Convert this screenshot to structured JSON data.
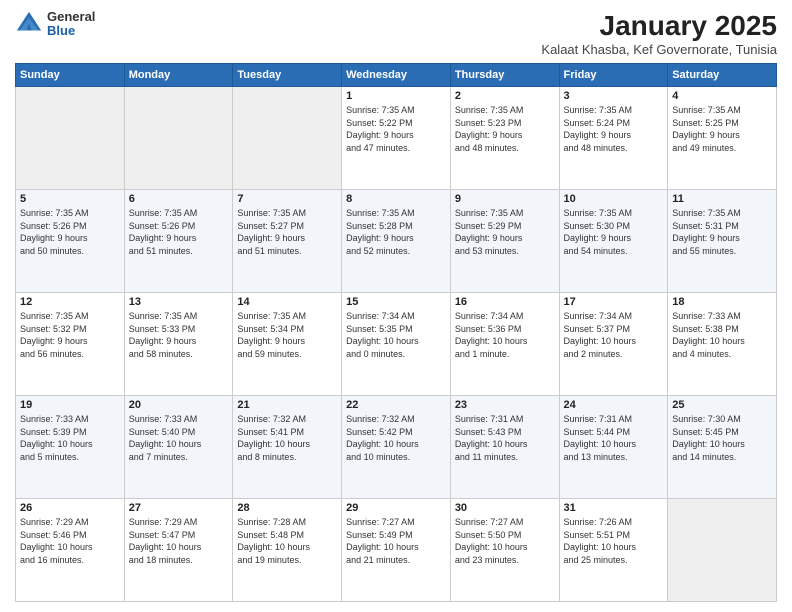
{
  "logo": {
    "general": "General",
    "blue": "Blue"
  },
  "title": "January 2025",
  "subtitle": "Kalaat Khasba, Kef Governorate, Tunisia",
  "days_of_week": [
    "Sunday",
    "Monday",
    "Tuesday",
    "Wednesday",
    "Thursday",
    "Friday",
    "Saturday"
  ],
  "weeks": [
    {
      "days": [
        {
          "num": "",
          "info": ""
        },
        {
          "num": "",
          "info": ""
        },
        {
          "num": "",
          "info": ""
        },
        {
          "num": "1",
          "info": "Sunrise: 7:35 AM\nSunset: 5:22 PM\nDaylight: 9 hours\nand 47 minutes."
        },
        {
          "num": "2",
          "info": "Sunrise: 7:35 AM\nSunset: 5:23 PM\nDaylight: 9 hours\nand 48 minutes."
        },
        {
          "num": "3",
          "info": "Sunrise: 7:35 AM\nSunset: 5:24 PM\nDaylight: 9 hours\nand 48 minutes."
        },
        {
          "num": "4",
          "info": "Sunrise: 7:35 AM\nSunset: 5:25 PM\nDaylight: 9 hours\nand 49 minutes."
        }
      ]
    },
    {
      "days": [
        {
          "num": "5",
          "info": "Sunrise: 7:35 AM\nSunset: 5:26 PM\nDaylight: 9 hours\nand 50 minutes."
        },
        {
          "num": "6",
          "info": "Sunrise: 7:35 AM\nSunset: 5:26 PM\nDaylight: 9 hours\nand 51 minutes."
        },
        {
          "num": "7",
          "info": "Sunrise: 7:35 AM\nSunset: 5:27 PM\nDaylight: 9 hours\nand 51 minutes."
        },
        {
          "num": "8",
          "info": "Sunrise: 7:35 AM\nSunset: 5:28 PM\nDaylight: 9 hours\nand 52 minutes."
        },
        {
          "num": "9",
          "info": "Sunrise: 7:35 AM\nSunset: 5:29 PM\nDaylight: 9 hours\nand 53 minutes."
        },
        {
          "num": "10",
          "info": "Sunrise: 7:35 AM\nSunset: 5:30 PM\nDaylight: 9 hours\nand 54 minutes."
        },
        {
          "num": "11",
          "info": "Sunrise: 7:35 AM\nSunset: 5:31 PM\nDaylight: 9 hours\nand 55 minutes."
        }
      ]
    },
    {
      "days": [
        {
          "num": "12",
          "info": "Sunrise: 7:35 AM\nSunset: 5:32 PM\nDaylight: 9 hours\nand 56 minutes."
        },
        {
          "num": "13",
          "info": "Sunrise: 7:35 AM\nSunset: 5:33 PM\nDaylight: 9 hours\nand 58 minutes."
        },
        {
          "num": "14",
          "info": "Sunrise: 7:35 AM\nSunset: 5:34 PM\nDaylight: 9 hours\nand 59 minutes."
        },
        {
          "num": "15",
          "info": "Sunrise: 7:34 AM\nSunset: 5:35 PM\nDaylight: 10 hours\nand 0 minutes."
        },
        {
          "num": "16",
          "info": "Sunrise: 7:34 AM\nSunset: 5:36 PM\nDaylight: 10 hours\nand 1 minute."
        },
        {
          "num": "17",
          "info": "Sunrise: 7:34 AM\nSunset: 5:37 PM\nDaylight: 10 hours\nand 2 minutes."
        },
        {
          "num": "18",
          "info": "Sunrise: 7:33 AM\nSunset: 5:38 PM\nDaylight: 10 hours\nand 4 minutes."
        }
      ]
    },
    {
      "days": [
        {
          "num": "19",
          "info": "Sunrise: 7:33 AM\nSunset: 5:39 PM\nDaylight: 10 hours\nand 5 minutes."
        },
        {
          "num": "20",
          "info": "Sunrise: 7:33 AM\nSunset: 5:40 PM\nDaylight: 10 hours\nand 7 minutes."
        },
        {
          "num": "21",
          "info": "Sunrise: 7:32 AM\nSunset: 5:41 PM\nDaylight: 10 hours\nand 8 minutes."
        },
        {
          "num": "22",
          "info": "Sunrise: 7:32 AM\nSunset: 5:42 PM\nDaylight: 10 hours\nand 10 minutes."
        },
        {
          "num": "23",
          "info": "Sunrise: 7:31 AM\nSunset: 5:43 PM\nDaylight: 10 hours\nand 11 minutes."
        },
        {
          "num": "24",
          "info": "Sunrise: 7:31 AM\nSunset: 5:44 PM\nDaylight: 10 hours\nand 13 minutes."
        },
        {
          "num": "25",
          "info": "Sunrise: 7:30 AM\nSunset: 5:45 PM\nDaylight: 10 hours\nand 14 minutes."
        }
      ]
    },
    {
      "days": [
        {
          "num": "26",
          "info": "Sunrise: 7:29 AM\nSunset: 5:46 PM\nDaylight: 10 hours\nand 16 minutes."
        },
        {
          "num": "27",
          "info": "Sunrise: 7:29 AM\nSunset: 5:47 PM\nDaylight: 10 hours\nand 18 minutes."
        },
        {
          "num": "28",
          "info": "Sunrise: 7:28 AM\nSunset: 5:48 PM\nDaylight: 10 hours\nand 19 minutes."
        },
        {
          "num": "29",
          "info": "Sunrise: 7:27 AM\nSunset: 5:49 PM\nDaylight: 10 hours\nand 21 minutes."
        },
        {
          "num": "30",
          "info": "Sunrise: 7:27 AM\nSunset: 5:50 PM\nDaylight: 10 hours\nand 23 minutes."
        },
        {
          "num": "31",
          "info": "Sunrise: 7:26 AM\nSunset: 5:51 PM\nDaylight: 10 hours\nand 25 minutes."
        },
        {
          "num": "",
          "info": ""
        }
      ]
    }
  ]
}
